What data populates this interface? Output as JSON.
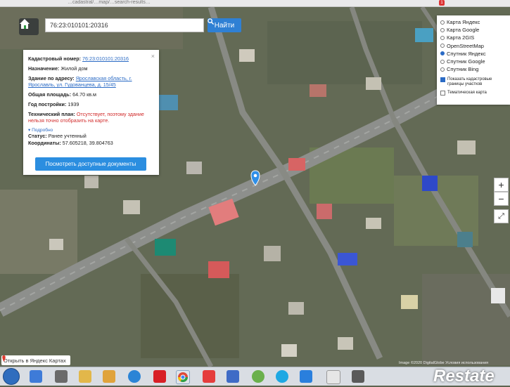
{
  "browser": {
    "url_fragment": "…cadastral/…map/…search-results…",
    "notification_badge": "1"
  },
  "search": {
    "value": "76:23:010101:20316",
    "button_label": "Найти"
  },
  "info_panel": {
    "close": "×",
    "cadastral_label": "Кадастровый номер:",
    "cadastral_value": "76:23:010101:20316",
    "purpose_label": "Назначение:",
    "purpose_value": "Жилой дом",
    "address_label": "Здание по адресу:",
    "address_value": "Ярославская область, г. Ярославль, ул. Гудованцева, д. 15/45",
    "area_label": "Общая площадь:",
    "area_value": "64.70 кв.м",
    "year_label": "Год постройки:",
    "year_value": "1939",
    "plan_label": "Технический план:",
    "plan_value": "Отсутствует, поэтому здание нельзя точно отобразить на карте.",
    "more_link": "Подробно",
    "status_label": "Статус:",
    "status_value": "Ранее учтенный",
    "coords_label": "Координаты:",
    "coords_value": "57.605218, 39.804763",
    "docs_button": "Посмотреть доступные документы"
  },
  "layers": {
    "options": [
      "Карта Яндекс",
      "Карта Google",
      "Карта 2GIS",
      "OpenStreetMap",
      "Спутник Яндекс",
      "Спутник Google",
      "Спутник Bing"
    ],
    "selected_index": 4,
    "show_boundaries": "Показать кадастровые границы участков",
    "show_boundaries_checked": true,
    "thematic_map": "Тематическая карта",
    "thematic_checked": false
  },
  "zoom": {
    "in": "+",
    "out": "−",
    "fullscreen": "⤢"
  },
  "open_in_yandex": "Открыть в Яндекс Картах",
  "copyright": "Image ©2020 DigitalGlobe  Условия использования",
  "watermark": "Restate",
  "colors": {
    "accent": "#2f80d4",
    "link": "#2b6bc5",
    "warning": "#d12a2a",
    "marker": "#2f8fe8"
  }
}
